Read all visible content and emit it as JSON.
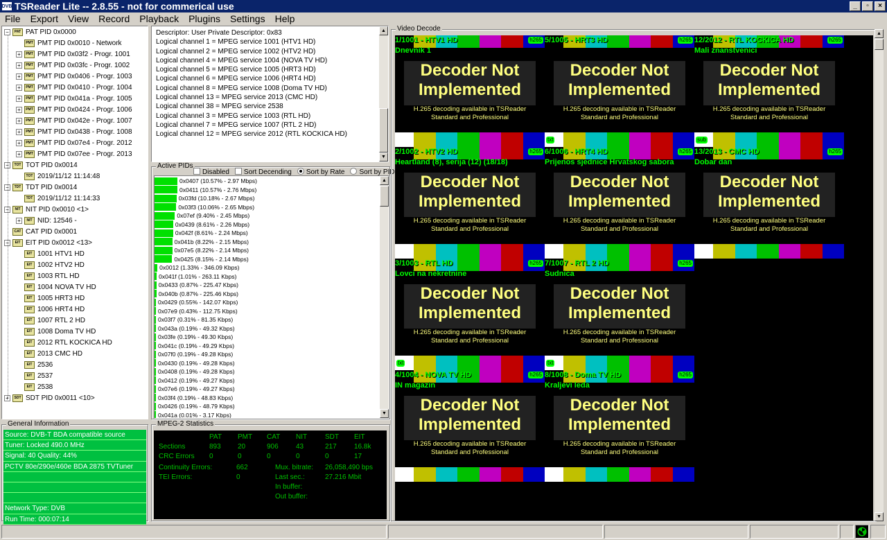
{
  "window": {
    "title": "TSReader Lite -- 2.8.55 - not for commerical use",
    "icon": "dvb-icon"
  },
  "menu": [
    "File",
    "Export",
    "View",
    "Record",
    "Playback",
    "Plugins",
    "Settings",
    "Help"
  ],
  "tree": [
    {
      "label": "PAT PID 0x0000",
      "icon": "PAT",
      "level": 0,
      "expander": "−"
    },
    {
      "label": "PMT PID 0x0010 - Network",
      "icon": "PMT",
      "level": 1,
      "expander": ""
    },
    {
      "label": "PMT PID 0x03f2 - Progr. 1001",
      "icon": "PMT",
      "level": 1,
      "expander": "+"
    },
    {
      "label": "PMT PID 0x03fc - Progr. 1002",
      "icon": "PMT",
      "level": 1,
      "expander": "+"
    },
    {
      "label": "PMT PID 0x0406 - Progr. 1003",
      "icon": "PMT",
      "level": 1,
      "expander": "+"
    },
    {
      "label": "PMT PID 0x0410 - Progr. 1004",
      "icon": "PMT",
      "level": 1,
      "expander": "+"
    },
    {
      "label": "PMT PID 0x041a - Progr. 1005",
      "icon": "PMT",
      "level": 1,
      "expander": "+"
    },
    {
      "label": "PMT PID 0x0424 - Progr. 1006",
      "icon": "PMT",
      "level": 1,
      "expander": "+"
    },
    {
      "label": "PMT PID 0x042e - Progr. 1007",
      "icon": "PMT",
      "level": 1,
      "expander": "+"
    },
    {
      "label": "PMT PID 0x0438 - Progr. 1008",
      "icon": "PMT",
      "level": 1,
      "expander": "+"
    },
    {
      "label": "PMT PID 0x07e4 - Progr. 2012",
      "icon": "PMT",
      "level": 1,
      "expander": "+"
    },
    {
      "label": "PMT PID 0x07ee - Progr. 2013",
      "icon": "PMT",
      "level": 1,
      "expander": "+"
    },
    {
      "label": "TOT PID 0x0014",
      "icon": "TOT",
      "level": 0,
      "expander": "−"
    },
    {
      "label": "2019/11/12 11:14:48",
      "icon": "TOT",
      "level": 1,
      "expander": ""
    },
    {
      "label": "TDT PID 0x0014",
      "icon": "TDT",
      "level": 0,
      "expander": "−"
    },
    {
      "label": "2019/11/12 11:14:33",
      "icon": "TDT",
      "level": 1,
      "expander": ""
    },
    {
      "label": "NIT PID 0x0010 <1>",
      "icon": "NIT",
      "level": 0,
      "expander": "−"
    },
    {
      "label": "NID: 12546 -",
      "icon": "NIT",
      "level": 1,
      "expander": "+"
    },
    {
      "label": "CAT PID 0x0001",
      "icon": "CAT",
      "level": 0,
      "expander": ""
    },
    {
      "label": "EIT PID 0x0012 <13>",
      "icon": "EIT",
      "level": 0,
      "expander": "−"
    },
    {
      "label": "1001 HTV1 HD",
      "icon": "EIT",
      "level": 1,
      "expander": ""
    },
    {
      "label": "1002 HTV2 HD",
      "icon": "EIT",
      "level": 1,
      "expander": ""
    },
    {
      "label": "1003 RTL HD",
      "icon": "EIT",
      "level": 1,
      "expander": ""
    },
    {
      "label": "1004 NOVA TV HD",
      "icon": "EIT",
      "level": 1,
      "expander": ""
    },
    {
      "label": "1005 HRT3 HD",
      "icon": "EIT",
      "level": 1,
      "expander": ""
    },
    {
      "label": "1006 HRT4 HD",
      "icon": "EIT",
      "level": 1,
      "expander": ""
    },
    {
      "label": "1007 RTL 2  HD",
      "icon": "EIT",
      "level": 1,
      "expander": ""
    },
    {
      "label": "1008 Doma TV HD",
      "icon": "EIT",
      "level": 1,
      "expander": ""
    },
    {
      "label": "2012 RTL KOCKICA HD",
      "icon": "EIT",
      "level": 1,
      "expander": ""
    },
    {
      "label": "2013 CMC HD",
      "icon": "EIT",
      "level": 1,
      "expander": ""
    },
    {
      "label": "2536",
      "icon": "EIT",
      "level": 1,
      "expander": ""
    },
    {
      "label": "2537",
      "icon": "EIT",
      "level": 1,
      "expander": ""
    },
    {
      "label": "2538",
      "icon": "EIT",
      "level": 1,
      "expander": ""
    },
    {
      "label": "SDT PID 0x0011 <10>",
      "icon": "SDT",
      "level": 0,
      "expander": "+"
    }
  ],
  "descriptor": [
    "Descriptor: User Private Descriptor: 0x83",
    "Logical channel 1 = MPEG service 1001 (HTV1 HD)",
    "Logical channel 2 = MPEG service 1002 (HTV2 HD)",
    "Logical channel 4 = MPEG service 1004 (NOVA TV HD)",
    "Logical channel 5 = MPEG service 1005 (HRT3 HD)",
    "Logical channel 6 = MPEG service 1006 (HRT4 HD)",
    "Logical channel 8 = MPEG service 1008 (Doma TV HD)",
    "Logical channel 13 = MPEG service 2013 (CMC HD)",
    "Logical channel 38 = MPEG service 2538",
    "Logical channel 3 = MPEG service 1003 (RTL HD)",
    "Logical channel 7 = MPEG service 1007 (RTL 2  HD)",
    "Logical channel 12 = MPEG service 2012 (RTL KOCKICA HD)"
  ],
  "active_pids": {
    "label": "Active PIDs",
    "options": {
      "disabled": "Disabled",
      "sort_desc": "Sort Decending",
      "sort_rate": "Sort by Rate",
      "sort_pid": "Sort by PID"
    },
    "rows": [
      {
        "text": "0x0407 (10.57% - 2.97 Mbps)",
        "pct": 10.57
      },
      {
        "text": "0x0411 (10.57% - 2.76 Mbps)",
        "pct": 10.57
      },
      {
        "text": "0x03fd (10.18% - 2.67 Mbps)",
        "pct": 10.18
      },
      {
        "text": "0x03f3 (10.06% - 2.65 Mbps)",
        "pct": 10.06
      },
      {
        "text": "0x07ef (9.40% - 2.45 Mbps)",
        "pct": 9.4
      },
      {
        "text": "0x0439 (8.61% - 2.26 Mbps)",
        "pct": 8.61
      },
      {
        "text": "0x042f (8.61% - 2.24 Mbps)",
        "pct": 8.61
      },
      {
        "text": "0x041b (8.22% - 2.15 Mbps)",
        "pct": 8.22
      },
      {
        "text": "0x07e5 (8.22% - 2.14 Mbps)",
        "pct": 8.22
      },
      {
        "text": "0x0425 (8.15% - 2.14 Mbps)",
        "pct": 8.15
      },
      {
        "text": "0x0012 (1.33% - 346.09 Kbps)",
        "pct": 1.33
      },
      {
        "text": "0x041f (1.01% - 263.11 Kbps)",
        "pct": 1.01
      },
      {
        "text": "0x0433 (0.87% - 225.47 Kbps)",
        "pct": 0.87
      },
      {
        "text": "0x040b (0.87% - 225.46 Kbps)",
        "pct": 0.87
      },
      {
        "text": "0x0429 (0.55% - 142.07 Kbps)",
        "pct": 0.55
      },
      {
        "text": "0x07e9 (0.43% - 112.75 Kbps)",
        "pct": 0.43
      },
      {
        "text": "0x03f7 (0.31% - 81.35 Kbps)",
        "pct": 0.31
      },
      {
        "text": "0x043a (0.19% - 49.32 Kbps)",
        "pct": 0.19
      },
      {
        "text": "0x03fe (0.19% - 49.30 Kbps)",
        "pct": 0.19
      },
      {
        "text": "0x041c (0.19% - 49.29 Kbps)",
        "pct": 0.19
      },
      {
        "text": "0x07f0 (0.19% - 49.28 Kbps)",
        "pct": 0.19
      },
      {
        "text": "0x0430 (0.19% - 49.28 Kbps)",
        "pct": 0.19
      },
      {
        "text": "0x0408 (0.19% - 49.28 Kbps)",
        "pct": 0.19
      },
      {
        "text": "0x0412 (0.19% - 49.27 Kbps)",
        "pct": 0.19
      },
      {
        "text": "0x07e6 (0.19% - 49.27 Kbps)",
        "pct": 0.19
      },
      {
        "text": "0x03f4 (0.19% - 48.83 Kbps)",
        "pct": 0.19
      },
      {
        "text": "0x0426 (0.19% - 48.79 Kbps)",
        "pct": 0.19
      },
      {
        "text": "0x041a (0.01% - 3.17 Kbps)",
        "pct": 0.01
      }
    ]
  },
  "general": {
    "label": "General Information",
    "lines": [
      "Source: DVB-T BDA compatible source",
      "Tuner: Locked 490.0 MHz",
      "Signal: 40 Quality: 44%",
      "PCTV 80e/290e/460e BDA 2875 TVTuner",
      "",
      "",
      "",
      "Network Type: DVB",
      "Run Time: 000:07:14"
    ]
  },
  "mpeg": {
    "label": "MPEG-2 Statistics",
    "headers": [
      "PAT",
      "PMT",
      "CAT",
      "NIT",
      "SDT",
      "EIT"
    ],
    "sections_label": "Sections",
    "sections": [
      "893",
      "20",
      "906",
      "43",
      "217",
      "16.8k"
    ],
    "crc_label": "CRC Errors",
    "crc": [
      "0",
      "0",
      "0",
      "0",
      "0",
      "17"
    ],
    "cont_label": "Continuity Errors:",
    "cont": "662",
    "tei_label": "TEI Errors:",
    "tei": "0",
    "mux_label": "Mux. bitrate:",
    "mux": "26,058,490 bps",
    "last_label": "Last sec.:",
    "last": "27.216 Mbit",
    "inbuf_label": "In buffer:",
    "outbuf_label": "Out buffer:"
  },
  "video": {
    "label": "Video Decode",
    "dni_title": "Decoder Not Implemented",
    "dni_sub": "H.265 decoding available in TSReader Standard and Professional",
    "codec_badge": "h265",
    "colors": [
      "#c0c000",
      "#00c0c0",
      "#00c000",
      "#c000c0",
      "#c00000",
      "#0000c0"
    ],
    "tiles": [
      {
        "channel": "1/1001 - HTV1 HD",
        "event": "Dnevnik 1",
        "badge": ""
      },
      {
        "channel": "5/1005 - HRT3 HD",
        "event": "",
        "badge": "txt"
      },
      {
        "channel": "12/2012 - RTL KOCKICA HD",
        "event": "Mali znanstvenici",
        "badge": "sub"
      },
      {
        "channel": "2/1002 - HTV2 HD",
        "event": "Heartland (8), serija (12) (18/18)",
        "badge": ""
      },
      {
        "channel": "6/1006 - HRT4 HD",
        "event": "Prijenos sjednice Hrvatskog sabora",
        "badge": ""
      },
      {
        "channel": "13/2013 - CMC HD",
        "event": "Dobar dan",
        "badge": ""
      },
      {
        "channel": "3/1003 - RTL HD",
        "event": "Lovci na nekretnine",
        "badge": "txt"
      },
      {
        "channel": "7/1007 - RTL 2  HD",
        "event": "Sudnica",
        "badge": "txt"
      },
      {
        "channel": "4/1004 - NOVA TV HD",
        "event": "IN magazin",
        "badge": ""
      },
      {
        "channel": "8/1008 - Doma TV HD",
        "event": "Kraljevi leda",
        "badge": ""
      }
    ]
  }
}
